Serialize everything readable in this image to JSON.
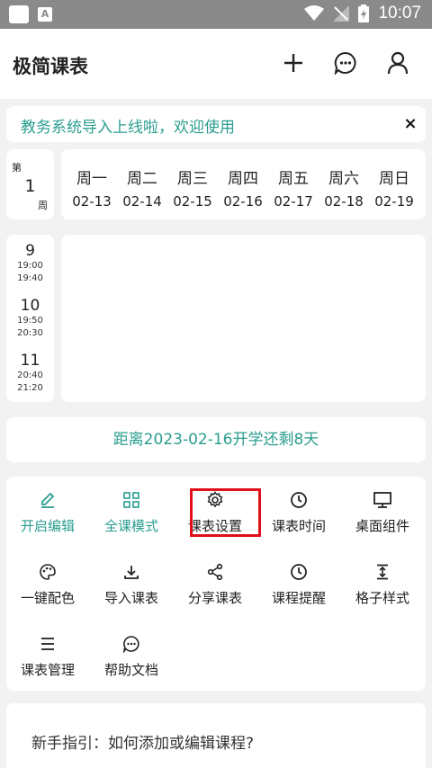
{
  "status_bar": {
    "time": "10:07",
    "notif_icon_text": "A"
  },
  "app_bar": {
    "title": "极简课表"
  },
  "banner": {
    "text": "教务系统导入上线啦，欢迎使用",
    "close": "×"
  },
  "week": {
    "prefix": "第",
    "number": "1",
    "suffix": "周"
  },
  "days": [
    {
      "name": "周一",
      "date": "02-13"
    },
    {
      "name": "周二",
      "date": "02-14"
    },
    {
      "name": "周三",
      "date": "02-15"
    },
    {
      "name": "周四",
      "date": "02-16"
    },
    {
      "name": "周五",
      "date": "02-17"
    },
    {
      "name": "周六",
      "date": "02-18"
    },
    {
      "name": "周日",
      "date": "02-19"
    }
  ],
  "periods": [
    {
      "num": "9",
      "start": "19:00",
      "end": "19:40"
    },
    {
      "num": "10",
      "start": "19:50",
      "end": "20:30"
    },
    {
      "num": "11",
      "start": "20:40",
      "end": "21:20"
    }
  ],
  "countdown": "距离2023-02-16开学还剩8天",
  "menu": {
    "edit": "开启编辑",
    "all_courses": "全课模式",
    "table_settings": "课表设置",
    "table_time": "课表时间",
    "widget": "桌面组件",
    "color": "一键配色",
    "import": "导入课表",
    "share": "分享课表",
    "reminder": "课程提醒",
    "cell_style": "格子样式",
    "manage": "课表管理",
    "help": "帮助文档"
  },
  "guide": {
    "text": "新手指引：如何添加或编辑课程?"
  },
  "colors": {
    "accent": "#2a9d8f",
    "highlight": "#e0101a",
    "statusbar": "#8a8a8a"
  },
  "icons": {
    "edit": "pencil-icon",
    "all_courses": "grid-icon",
    "table_settings": "gear-icon",
    "table_time": "clock-icon",
    "widget": "monitor-icon",
    "color": "palette-icon",
    "import": "download-icon",
    "share": "share-icon",
    "reminder": "clock-icon",
    "cell_style": "height-icon",
    "manage": "list-icon",
    "help": "chat-icon"
  }
}
